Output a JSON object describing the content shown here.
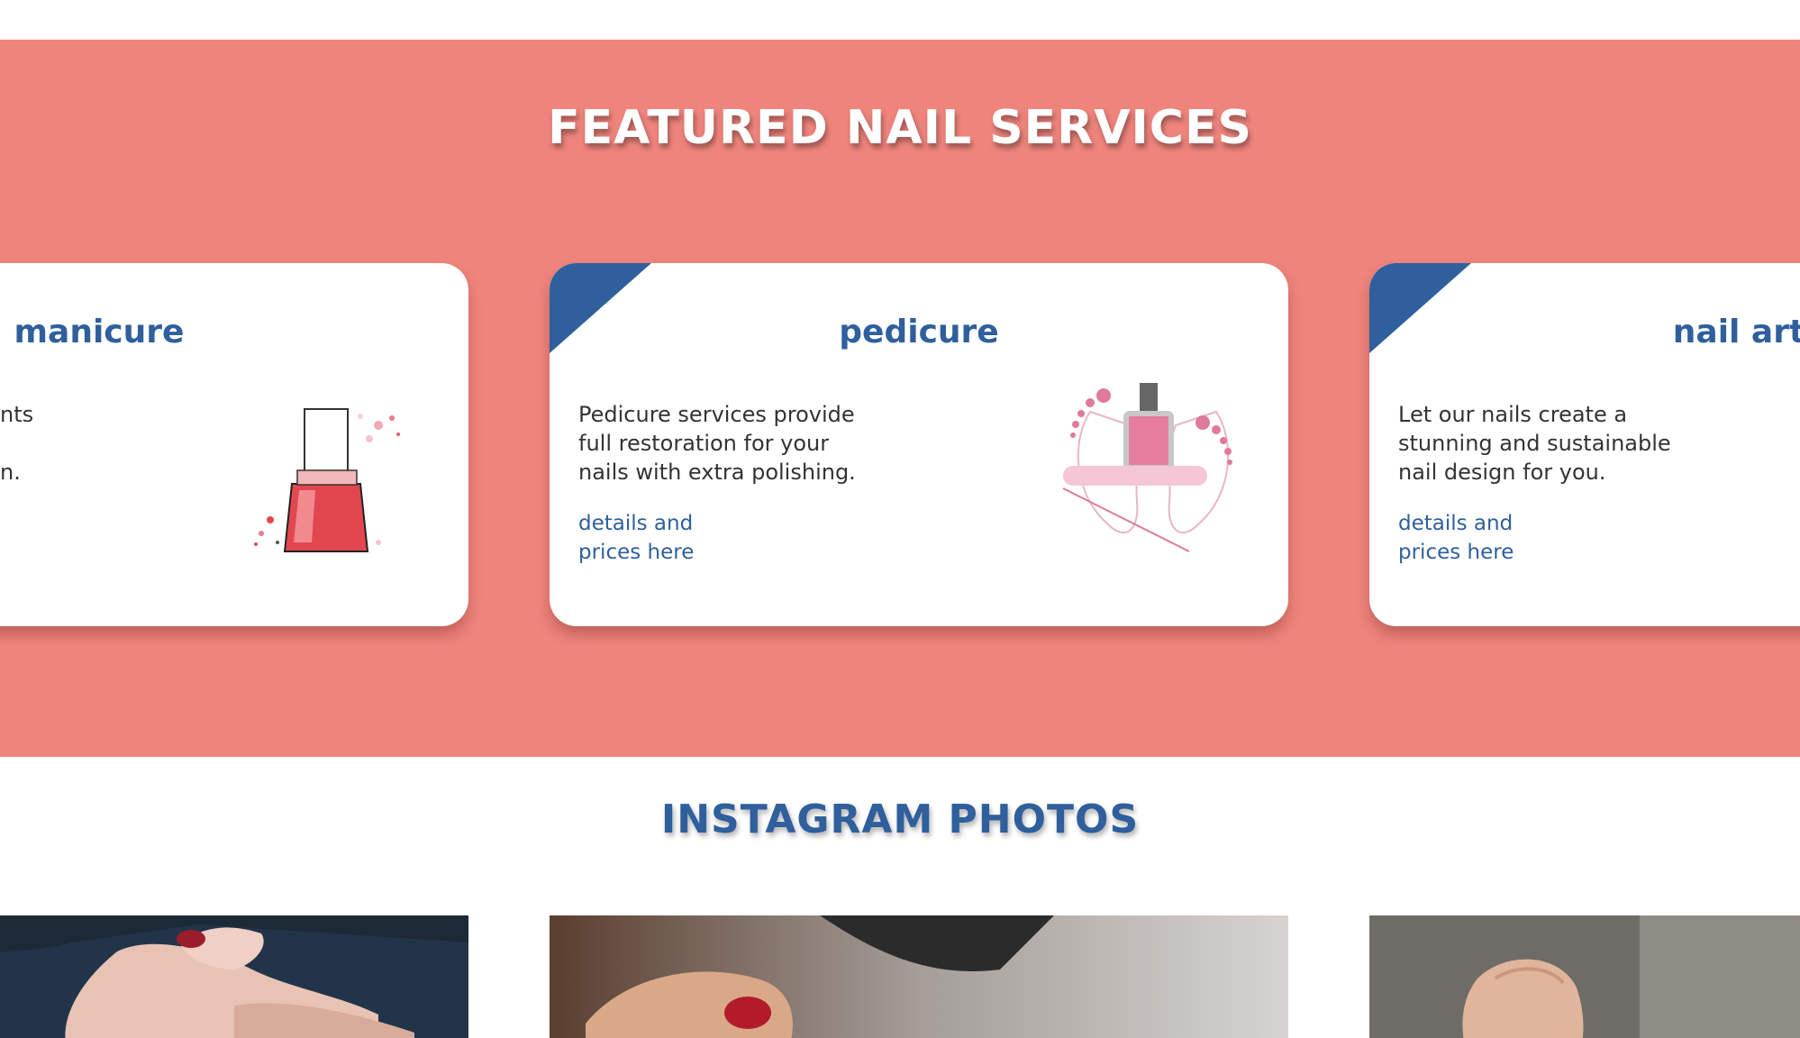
{
  "featured": {
    "title": "FEATURED NAIL SERVICES",
    "cards": [
      {
        "title": "manicure",
        "text_fragments": [
          "nts",
          "n."
        ],
        "icon": "nail-polish-bottle-illustration"
      },
      {
        "title": "pedicure",
        "text": "Pedicure services provide full restoration for your nails with extra polishing.",
        "link_line1": "details and",
        "link_line2": "prices here",
        "icon": "pedicure-feet-polish-illustration"
      },
      {
        "title": "nail art",
        "text": "Let our nails create a stunning and sustainable nail design for you.",
        "link_line1": "details and",
        "link_line2": "prices here"
      }
    ]
  },
  "instagram": {
    "title": "INSTAGRAM PHOTOS",
    "photos": [
      "manicured-hand-photo",
      "red-nail-polish-photo",
      "finger-photo"
    ]
  },
  "colors": {
    "featured_bg": "#ee847c",
    "accent_blue": "#2f5f9c",
    "card_bg": "#ffffff",
    "text": "#333333"
  }
}
